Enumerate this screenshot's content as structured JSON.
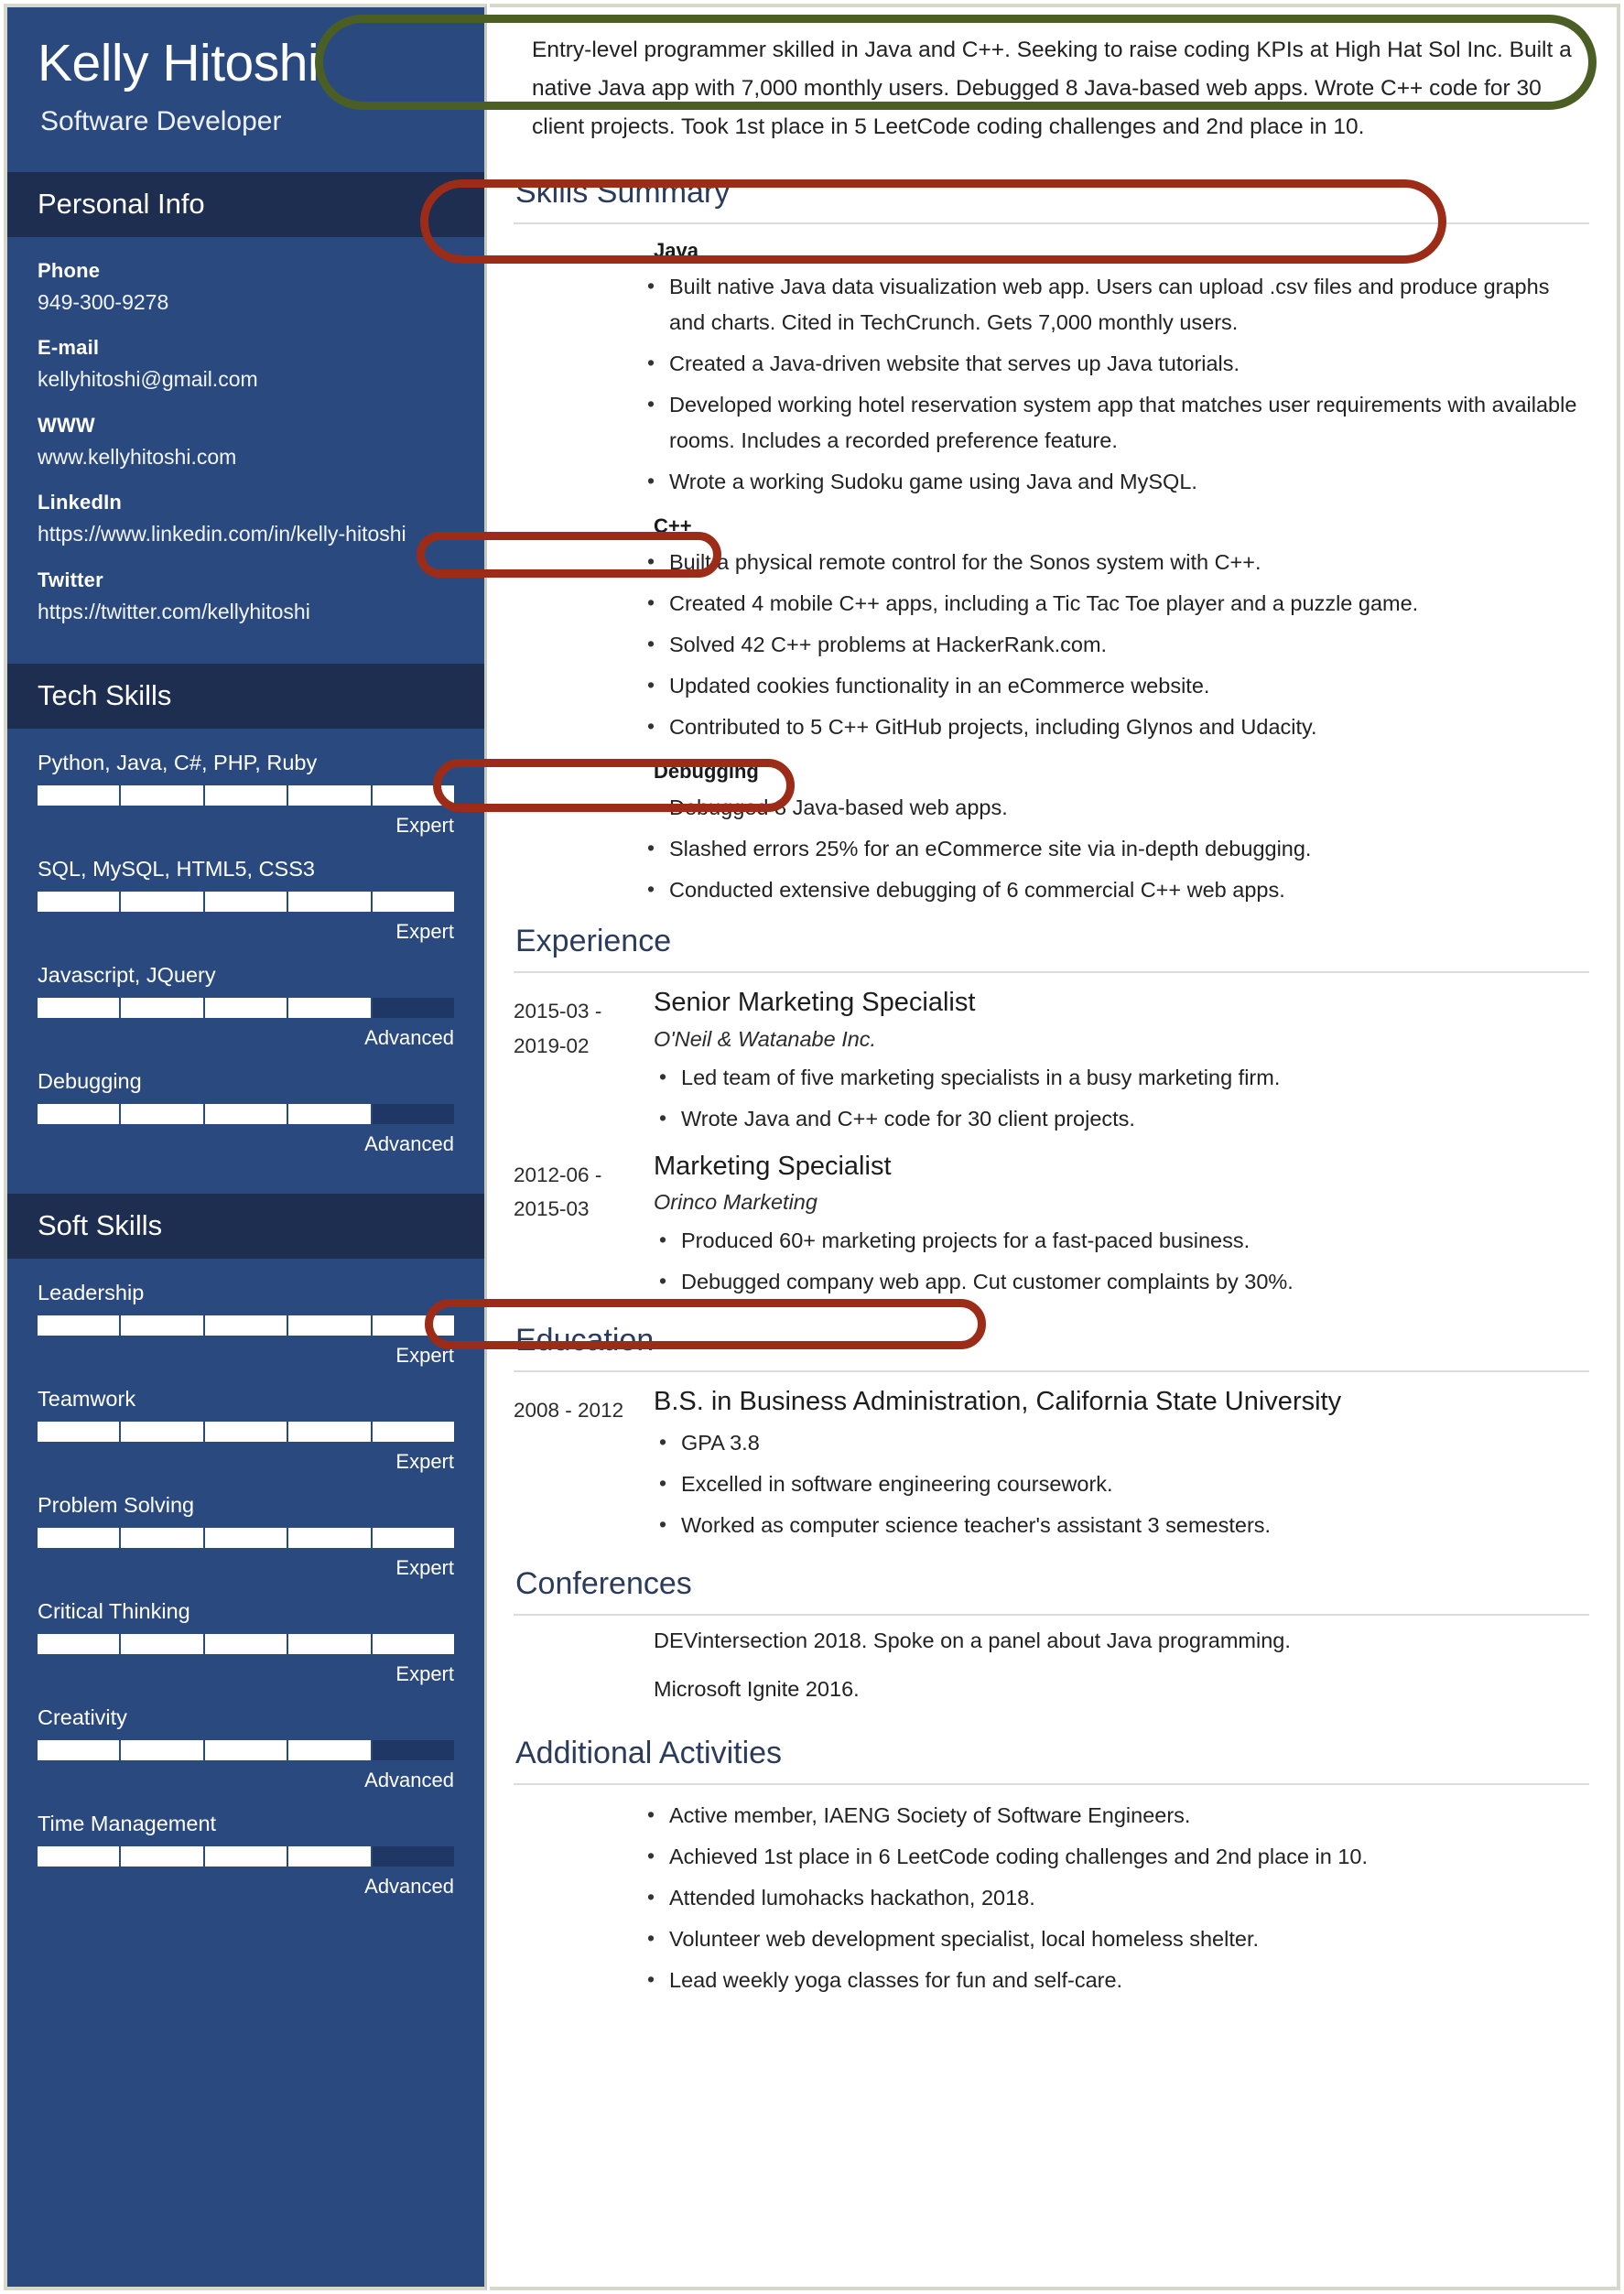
{
  "sidebar": {
    "name": "Kelly Hitoshi",
    "role": "Software Developer",
    "personal_info_heading": "Personal Info",
    "contacts": [
      {
        "label": "Phone",
        "value": "949-300-9278"
      },
      {
        "label": "E-mail",
        "value": "kellyhitoshi@gmail.com"
      },
      {
        "label": "WWW",
        "value": "www.kellyhitoshi.com"
      },
      {
        "label": "LinkedIn",
        "value": "https://www.linkedin.com/in/kelly-hitoshi"
      },
      {
        "label": "Twitter",
        "value": "https://twitter.com/kellyhitoshi"
      }
    ],
    "tech_skills_heading": "Tech Skills",
    "tech_skills": [
      {
        "label": "Python, Java, C#, PHP, Ruby",
        "level": "Expert",
        "filled": 5,
        "total": 5
      },
      {
        "label": "SQL, MySQL, HTML5, CSS3",
        "level": "Expert",
        "filled": 5,
        "total": 5
      },
      {
        "label": "Javascript, JQuery",
        "level": "Advanced",
        "filled": 4,
        "total": 5
      },
      {
        "label": "Debugging",
        "level": "Advanced",
        "filled": 4,
        "total": 5
      }
    ],
    "soft_skills_heading": "Soft Skills",
    "soft_skills": [
      {
        "label": "Leadership",
        "level": "Expert",
        "filled": 5,
        "total": 5
      },
      {
        "label": "Teamwork",
        "level": "Expert",
        "filled": 5,
        "total": 5
      },
      {
        "label": "Problem Solving",
        "level": "Expert",
        "filled": 5,
        "total": 5
      },
      {
        "label": "Critical Thinking",
        "level": "Expert",
        "filled": 5,
        "total": 5
      },
      {
        "label": "Creativity",
        "level": "Advanced",
        "filled": 4,
        "total": 5
      },
      {
        "label": "Time Management",
        "level": "Advanced",
        "filled": 4,
        "total": 5
      }
    ]
  },
  "main": {
    "summary": "Entry-level programmer skilled in Java and C++. Seeking to raise coding KPIs at High Hat Sol Inc. Built a native Java app with 7,000 monthly users. Debugged 8 Java-based web apps. Wrote C++ code for 30 client projects. Took 1st place in 5 LeetCode coding challenges and 2nd place in 10.",
    "skills_summary": {
      "heading": "Skills Summary",
      "groups": [
        {
          "title": "Java",
          "bullets": [
            "Built native Java data visualization web app. Users can upload .csv files and produce graphs and charts. Cited in TechCrunch. Gets 7,000 monthly users.",
            "Created a Java-driven website that serves up Java tutorials.",
            "Developed working hotel reservation system app that matches user requirements with available rooms. Includes a recorded preference feature.",
            "Wrote a working Sudoku game using Java and MySQL."
          ]
        },
        {
          "title": "C++",
          "bullets": [
            "Built a physical remote control for the Sonos system with C++.",
            "Created 4 mobile C++ apps, including a Tic Tac Toe player and a puzzle game.",
            "Solved 42 C++ problems at HackerRank.com.",
            "Updated cookies functionality in an eCommerce website.",
            "Contributed to 5 C++ GitHub projects, including Glynos and Udacity."
          ]
        },
        {
          "title": "Debugging",
          "bullets": [
            "Debugged 8 Java-based web apps.",
            "Slashed errors 25% for an eCommerce site via in-depth debugging.",
            "Conducted extensive debugging of 6 commercial C++ web apps."
          ]
        }
      ]
    },
    "experience": {
      "heading": "Experience",
      "entries": [
        {
          "date": "2015-03 - 2019-02",
          "title": "Senior Marketing Specialist",
          "org": "O'Neil & Watanabe Inc.",
          "bullets": [
            "Led team of five marketing specialists in a busy marketing firm.",
            "Wrote Java and C++ code for 30 client projects."
          ]
        },
        {
          "date": "2012-06 - 2015-03",
          "title": "Marketing Specialist",
          "org": "Orinco Marketing",
          "bullets": [
            "Produced 60+ marketing projects for a fast-paced business.",
            "Debugged company web app. Cut customer complaints by 30%."
          ]
        }
      ]
    },
    "education": {
      "heading": "Education",
      "entries": [
        {
          "date": "2008 - 2012",
          "title": "B.S. in Business Administration, California State University",
          "bullets": [
            "GPA 3.8",
            "Excelled in software engineering coursework.",
            "Worked as computer science teacher's assistant 3 semesters."
          ]
        }
      ]
    },
    "conferences": {
      "heading": "Conferences",
      "lines": [
        "DEVintersection 2018. Spoke on a panel about Java programming.",
        "Microsoft Ignite 2016."
      ]
    },
    "additional_activities": {
      "heading": "Additional Activities",
      "bullets": [
        "Active member, IAENG Society of Software Engineers.",
        "Achieved 1st place in 6 LeetCode coding challenges and 2nd place in 10.",
        "Attended lumohacks hackathon, 2018.",
        "Volunteer web development specialist, local homeless shelter.",
        "Lead weekly yoga classes for fun and self-care."
      ]
    }
  },
  "annotations": {
    "summary_circle_color": "#4b5f24",
    "highlight_circle_color": "#9c2b18"
  },
  "colors": {
    "sidebar_bg": "#2a4a7f",
    "sidebar_header_bg": "#1e2e50",
    "section_title": "#2b3b5c",
    "page_bg": "#ffffff",
    "border": "#d7d8cc"
  }
}
